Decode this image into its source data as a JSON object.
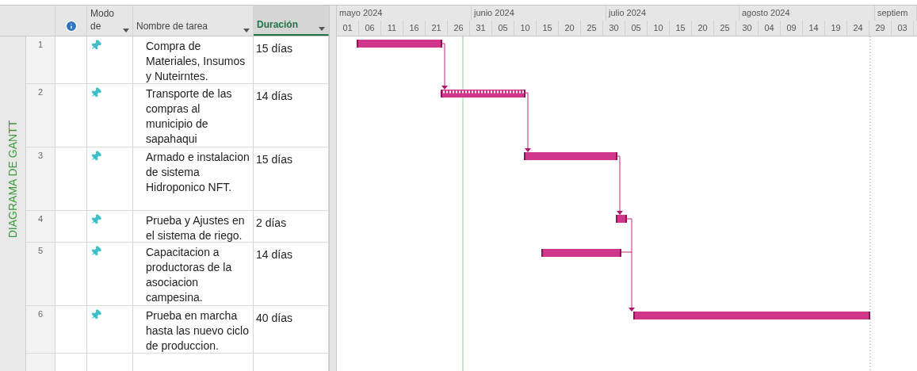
{
  "side_label": "DIAGRAMA DE GANTT",
  "columns": [
    {
      "kind": "info",
      "selected": false
    },
    {
      "kind": "text",
      "label": "Modo de",
      "selected": false
    },
    {
      "kind": "text",
      "label": "Nombre de tarea",
      "selected": false
    },
    {
      "kind": "text",
      "label": "Duración",
      "selected": true
    }
  ],
  "timescale": {
    "months": [
      "mayo 2024",
      "junio 2024",
      "julio 2024",
      "agosto 2024",
      "septiem"
    ],
    "days": [
      "01",
      "06",
      "11",
      "16",
      "21",
      "26",
      "31",
      "05",
      "10",
      "15",
      "20",
      "25",
      "30",
      "05",
      "10",
      "15",
      "20",
      "25",
      "30",
      "04",
      "09",
      "14",
      "19",
      "24",
      "29",
      "03"
    ]
  },
  "tasks": [
    {
      "number": "1",
      "name": "Compra de Materiales, Insumos y Nuteirntes.",
      "duration": "15 días"
    },
    {
      "number": "2",
      "name": "Transporte de las compras al municipio de sapahaqui",
      "duration": "14 días"
    },
    {
      "number": "3",
      "name": "Armado e instalacion de sistema Hidroponico NFT.",
      "duration": "15 días"
    },
    {
      "number": "4",
      "name": "Prueba y Ajustes en el sistema de riego.",
      "duration": "2 días"
    },
    {
      "number": "5",
      "name": "Capacitacion a productoras de la asociacion campesina.",
      "duration": "14 días"
    },
    {
      "number": "6",
      "name": "Prueba en marcha hasta las nuevo ciclo de produccion.",
      "duration": "40 días"
    }
  ]
}
